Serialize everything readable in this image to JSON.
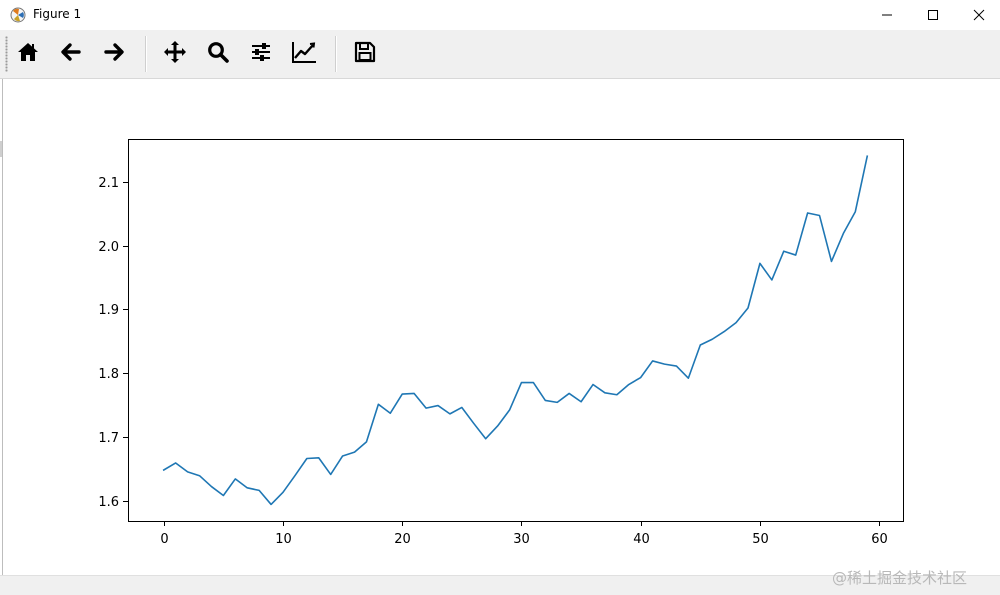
{
  "window": {
    "title": "Figure 1",
    "icons": {
      "app": "matplotlib-figure-icon",
      "minimize": "minimize-icon",
      "maximize": "maximize-icon",
      "close": "close-icon"
    }
  },
  "toolbar": {
    "buttons": [
      {
        "name": "home-button",
        "icon": "home-icon"
      },
      {
        "name": "back-button",
        "icon": "arrow-left-icon"
      },
      {
        "name": "forward-button",
        "icon": "arrow-right-icon"
      },
      {
        "name": "pan-button",
        "icon": "move-icon"
      },
      {
        "name": "zoom-button",
        "icon": "search-icon"
      },
      {
        "name": "subplots-button",
        "icon": "sliders-icon"
      },
      {
        "name": "edit-axes-button",
        "icon": "line-chart-icon"
      },
      {
        "name": "save-button",
        "icon": "save-icon"
      }
    ]
  },
  "watermark": "@稀土掘金技术社区",
  "colors": {
    "line": "#1f77b4",
    "toolbar_bg": "#f0f0f0"
  },
  "chart_data": {
    "type": "line",
    "title": "",
    "xlabel": "",
    "ylabel": "",
    "xlim": [
      -3,
      62
    ],
    "ylim": [
      1.568,
      2.167
    ],
    "grid": false,
    "xticks": [
      0,
      10,
      20,
      30,
      40,
      50,
      60
    ],
    "xtick_labels": [
      "0",
      "10",
      "20",
      "30",
      "40",
      "50",
      "60"
    ],
    "yticks": [
      1.6,
      1.7,
      1.8,
      1.9,
      2.0,
      2.1
    ],
    "ytick_labels": [
      "1.6",
      "1.7",
      "1.8",
      "1.9",
      "2.0",
      "2.1"
    ],
    "series": [
      {
        "color": "#1f77b4",
        "x": [
          0,
          1,
          2,
          3,
          4,
          5,
          6,
          7,
          8,
          9,
          10,
          11,
          12,
          13,
          14,
          15,
          16,
          17,
          18,
          19,
          20,
          21,
          22,
          23,
          24,
          25,
          26,
          27,
          28,
          29,
          30,
          31,
          32,
          33,
          34,
          35,
          36,
          37,
          38,
          39,
          40,
          41,
          42,
          43,
          44,
          45,
          46,
          47,
          48,
          49,
          50,
          51,
          52,
          53,
          54,
          55,
          56,
          57,
          58,
          59
        ],
        "y": [
          1.648,
          1.659,
          1.645,
          1.639,
          1.622,
          1.608,
          1.634,
          1.62,
          1.616,
          1.594,
          1.613,
          1.639,
          1.666,
          1.667,
          1.641,
          1.67,
          1.676,
          1.692,
          1.751,
          1.737,
          1.767,
          1.768,
          1.745,
          1.749,
          1.736,
          1.746,
          1.721,
          1.697,
          1.717,
          1.742,
          1.785,
          1.785,
          1.757,
          1.754,
          1.768,
          1.755,
          1.782,
          1.769,
          1.766,
          1.782,
          1.793,
          1.819,
          1.814,
          1.811,
          1.792,
          1.844,
          1.853,
          1.865,
          1.879,
          1.902,
          1.972,
          1.946,
          1.991,
          1.985,
          2.051,
          2.047,
          1.975,
          2.019,
          2.053,
          2.14
        ]
      }
    ]
  }
}
